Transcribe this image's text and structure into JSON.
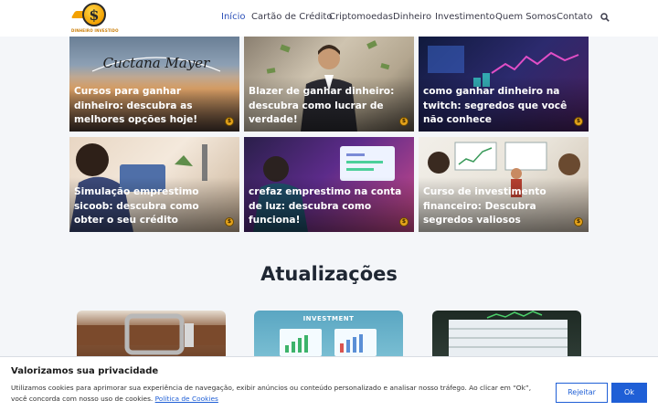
{
  "brand": {
    "logo_symbol": "$",
    "logo_text": "DINHEIRO INVESTIDO",
    "accent": "#f3a100"
  },
  "nav": {
    "items": [
      {
        "label": "Início",
        "active": true
      },
      {
        "label": "Cartão de Crédito",
        "active": false
      },
      {
        "label": "Criptomoedas",
        "active": false
      },
      {
        "label": "Dinheiro",
        "active": false
      },
      {
        "label": "Investimento",
        "active": false
      },
      {
        "label": "Quem Somos",
        "active": false
      },
      {
        "label": "Contato",
        "active": false
      }
    ],
    "search_icon": "search-icon",
    "active_color": "#2b4fb8"
  },
  "cards": [
    {
      "title": "Cursos para ganhar dinheiro: descubra as melhores opções hoje!",
      "image_text": "Cuctana Mayer"
    },
    {
      "title": "Blazer de ganhar dinheiro: descubra como lucrar de verdade!"
    },
    {
      "title": "como ganhar dinheiro na twitch: segredos que você não conhece"
    },
    {
      "title": "Simulação emprestimo sicoob: descubra como obter o seu crédito"
    },
    {
      "title": "crefaz emprestimo na conta de luz: descubra como funciona!"
    },
    {
      "title": "Curso de investimento financeiro: Descubra segredos valiosos"
    }
  ],
  "updates": {
    "heading": "Atualizações",
    "items": [
      {
        "label": ""
      },
      {
        "label": "INVESTMENT"
      },
      {
        "label": ""
      }
    ]
  },
  "cookie": {
    "title": "Valorizamos sua privacidade",
    "text": "Utilizamos cookies para aprimorar sua experiência de navegação, exibir anúncios ou conteúdo personalizado e analisar nosso tráfego. Ao clicar em “Ok”, você concorda com nosso uso de cookies.",
    "link_label": "Política de Cookies",
    "reject_label": "Rejeitar",
    "ok_label": "Ok",
    "button_color": "#1f5fd6"
  }
}
